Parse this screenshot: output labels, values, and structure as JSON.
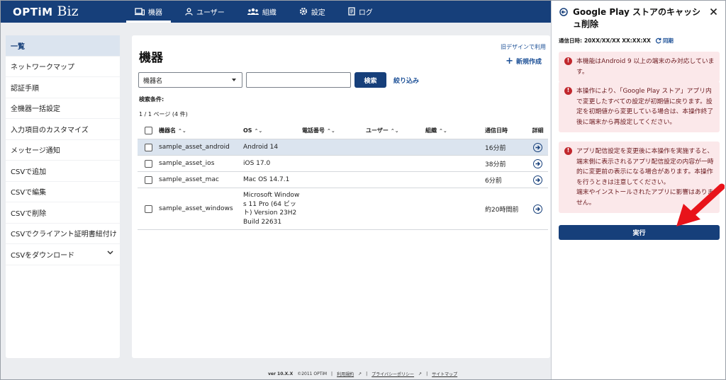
{
  "app": {
    "logo_main": "OPTiM",
    "logo_sub": "Biz"
  },
  "nav": [
    {
      "label": "機器",
      "icon": "device-icon",
      "active": true
    },
    {
      "label": "ユーザー",
      "icon": "user-icon"
    },
    {
      "label": "組織",
      "icon": "organization-icon"
    },
    {
      "label": "設定",
      "icon": "gear-icon"
    },
    {
      "label": "ログ",
      "icon": "log-icon"
    }
  ],
  "sidebar": {
    "items": [
      {
        "label": "一覧",
        "active": true
      },
      {
        "label": "ネットワークマップ"
      },
      {
        "label": "認証手順"
      },
      {
        "label": "全機器一括設定"
      },
      {
        "label": "入力項目のカスタマイズ"
      },
      {
        "label": "メッセージ通知"
      },
      {
        "label": "CSVで追加"
      },
      {
        "label": "CSVで編集"
      },
      {
        "label": "CSVで削除"
      },
      {
        "label": "CSVでクライアント証明書紐付け"
      },
      {
        "label": "CSVをダウンロード"
      }
    ]
  },
  "main": {
    "title": "機器",
    "old_design_link": "旧デザインで利用",
    "new_create": "新規作成",
    "filter_select": "機器名",
    "search_button": "検索",
    "narrow_link": "絞り込み",
    "conditions_label": "検索条件:",
    "pager": "1 / 1 ページ (4 件)"
  },
  "table": {
    "headers": [
      "機器名",
      "OS",
      "電話番号",
      "ユーザー",
      "組織",
      "通信日時",
      "詳細"
    ],
    "rows": [
      {
        "name": "sample_asset_android",
        "os": "Android 14",
        "time": "16分前"
      },
      {
        "name": "sample_asset_ios",
        "os": "iOS 17.0",
        "time": "38分前"
      },
      {
        "name": "sample_asset_mac",
        "os": "Mac OS 14.7.1",
        "time": "6分前"
      },
      {
        "name": "sample_asset_windows",
        "os_lines": [
          "Microsoft Window",
          "s 11 Pro (64 ビッ",
          "ト) Version 23H2",
          "Build 22631"
        ],
        "time": "約20時間前"
      }
    ]
  },
  "footer": {
    "version": "ver 10.X.X",
    "copyright": "©2011 OPTiM",
    "terms": "利用規約",
    "privacy": "プライバシーポリシー",
    "sitemap": "サイトマップ"
  },
  "panel": {
    "title": "Google Play ストアのキャッシュ削除",
    "comm_label": "通信日時:",
    "comm_value": "20XX/XX/XX XX:XX:XX",
    "sync_label": "同期",
    "alerts": [
      "本機能はAndroid 9 以上の端末のみ対応しています。",
      "本操作により、「Google Play ストア」アプリ内で変更したすべての設定が初期値に戻ります。設定を初期値から変更している場合は、本操作終了後に端末から再設定してください。",
      "アプリ配信設定を変更後に本操作を実施すると、端末側に表示されるアプリ配信設定の内容が一時的に変更前の表示になる場合があります。本操作を行うときは注意してください。",
      "端末やインストールされたアプリに影響はありません。"
    ],
    "execute_button": "実行"
  },
  "colors": {
    "primary": "#163f7a",
    "alert_bg": "#fbe8ea",
    "alert_icon": "#c1272d",
    "annotation_arrow": "#e8131a"
  }
}
